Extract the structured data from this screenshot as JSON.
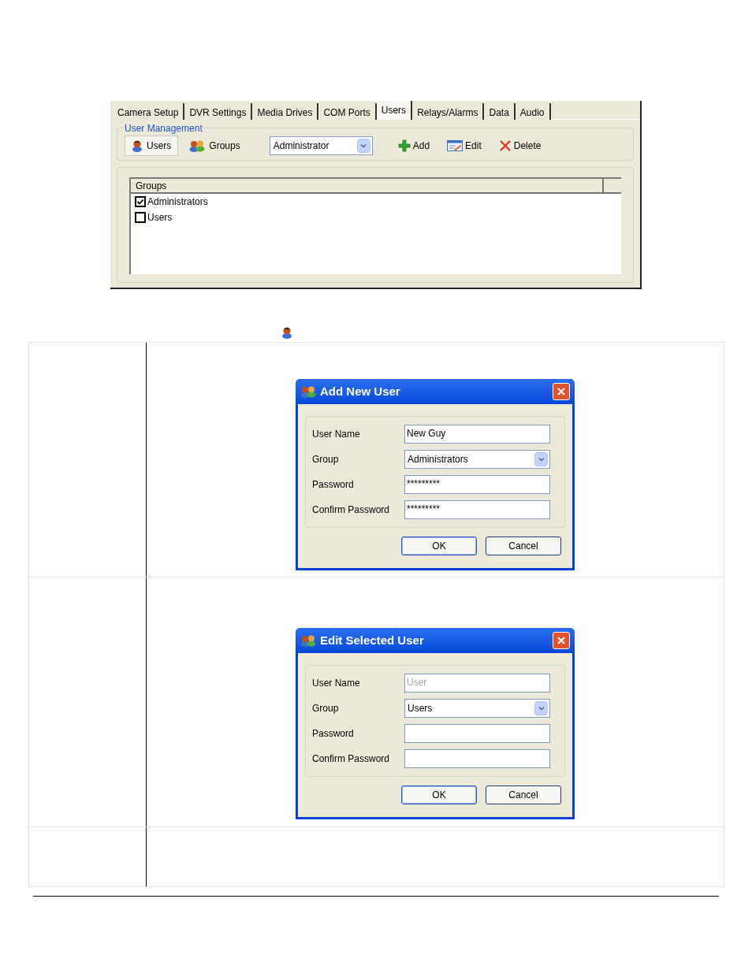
{
  "settings_window": {
    "tabs": [
      {
        "label": "Camera Setup",
        "selected": false
      },
      {
        "label": "DVR Settings",
        "selected": false
      },
      {
        "label": "Media Drives",
        "selected": false
      },
      {
        "label": "COM Ports",
        "selected": false
      },
      {
        "label": "Users",
        "selected": true
      },
      {
        "label": "Relays/Alarms",
        "selected": false
      },
      {
        "label": "Data",
        "selected": false
      },
      {
        "label": "Audio",
        "selected": false
      }
    ],
    "group_title": "User Management",
    "view_buttons": [
      {
        "kind": "user",
        "label": "Users",
        "selected": true
      },
      {
        "kind": "group",
        "label": "Groups",
        "selected": false
      }
    ],
    "user_dropdown": {
      "value": "Administrator"
    },
    "actions": [
      {
        "kind": "add",
        "label": "Add"
      },
      {
        "kind": "edit",
        "label": "Edit"
      },
      {
        "kind": "delete",
        "label": "Delete"
      }
    ],
    "groups_list": {
      "header": "Groups",
      "rows": [
        {
          "label": "Administrators",
          "checked": true
        },
        {
          "label": "Users",
          "checked": false
        }
      ]
    }
  },
  "dialogs": [
    {
      "title": "Add New User",
      "fields": [
        {
          "kind": "text",
          "label": "User Name",
          "value": "New Guy"
        },
        {
          "kind": "select",
          "label": "Group",
          "value": "Administrators"
        },
        {
          "kind": "text",
          "label": "Password",
          "value": "*********"
        },
        {
          "kind": "text",
          "label": "Confirm Password",
          "value": "*********"
        }
      ],
      "buttons": [
        "OK",
        "Cancel"
      ]
    },
    {
      "title": "Edit Selected User",
      "fields": [
        {
          "kind": "text",
          "label": "User Name",
          "placeholder": "User"
        },
        {
          "kind": "select",
          "label": "Group",
          "value": "Users"
        },
        {
          "kind": "text",
          "label": "Password"
        },
        {
          "kind": "text",
          "label": "Confirm Password"
        }
      ],
      "buttons": [
        "OK",
        "Cancel"
      ]
    }
  ]
}
